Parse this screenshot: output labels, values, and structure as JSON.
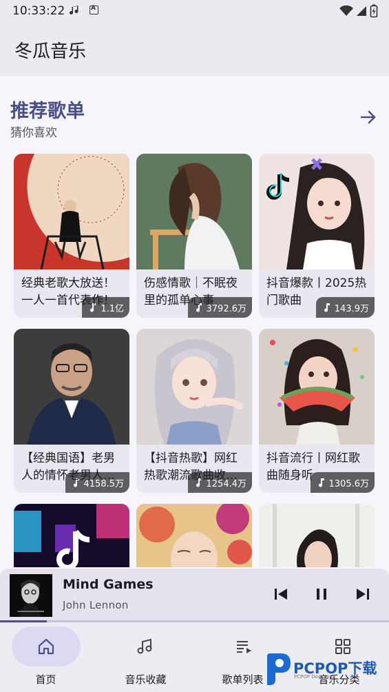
{
  "status_bar": {
    "time": "10:33:22"
  },
  "app": {
    "title": "冬瓜音乐"
  },
  "section": {
    "title": "推荐歌单",
    "subtitle": "猜你喜欢"
  },
  "playlists": [
    {
      "title": "经典老歌大放送！一人一首代表作！",
      "plays": "1.1亿"
    },
    {
      "title": "伤感情歌｜不眠夜里的孤单心事",
      "plays": "3792.6万"
    },
    {
      "title": "抖音爆款丨2025热门歌曲",
      "plays": "143.9万"
    },
    {
      "title": "【经典国语】老男人的情怀老男人…",
      "plays": "4158.5万"
    },
    {
      "title": "【抖音热歌】网红热歌潮流歌曲收…",
      "plays": "1254.4万"
    },
    {
      "title": "抖音流行丨网红歌曲随身听",
      "plays": "1305.6万"
    }
  ],
  "player": {
    "title": "Mind Games",
    "artist": "John Lennon",
    "progress": 0.12
  },
  "nav": [
    {
      "label": "首页",
      "icon": "home-icon",
      "active": true
    },
    {
      "label": "音乐收藏",
      "icon": "music-note-icon",
      "active": false
    },
    {
      "label": "歌单列表",
      "icon": "playlist-icon",
      "active": false
    },
    {
      "label": "音乐分类",
      "icon": "grid-icon",
      "active": false
    }
  ],
  "watermark": {
    "text": "PCPOP下载",
    "sub": "PCPOP Download"
  },
  "colors": {
    "accent": "#4a5085",
    "nav_active": "#dcdaf3",
    "background": "#f7f5fc"
  }
}
